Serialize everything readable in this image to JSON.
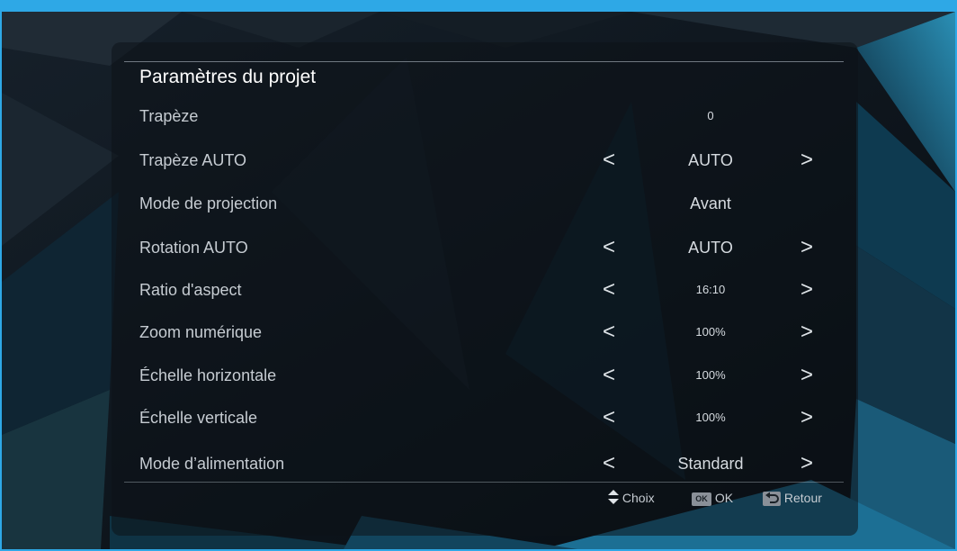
{
  "menu": {
    "title": "Paramètres du projet",
    "items": [
      {
        "label": "Trapèze",
        "value": "0",
        "arrows": false,
        "value_size": "sm"
      },
      {
        "label": "Trapèze AUTO",
        "value": "AUTO",
        "arrows": true,
        "value_size": "lg"
      },
      {
        "label": "Mode de projection",
        "value": "Avant",
        "arrows": false,
        "value_size": "lg"
      },
      {
        "label": "Rotation AUTO",
        "value": "AUTO",
        "arrows": true,
        "value_size": "lg"
      },
      {
        "label": "Ratio d'aspect",
        "value": "16:10",
        "arrows": true,
        "value_size": "sm"
      },
      {
        "label": "Zoom numérique",
        "value": "100%",
        "arrows": true,
        "value_size": "sm"
      },
      {
        "label": "Échelle horizontale",
        "value": "100%",
        "arrows": true,
        "value_size": "sm"
      },
      {
        "label": "Échelle verticale",
        "value": "100%",
        "arrows": true,
        "value_size": "sm"
      },
      {
        "label": "Mode d’alimentation",
        "value": "Standard",
        "arrows": true,
        "value_size": "lg"
      }
    ],
    "arrow_left": "<",
    "arrow_right": ">"
  },
  "footer": {
    "choix_label": "Choix",
    "ok_key": "OK",
    "ok_label": "OK",
    "retour_label": "Retour",
    "icons": {
      "choix": "up-down-icon",
      "ok": "ok-key-icon",
      "retour": "return-icon"
    }
  },
  "colors": {
    "frame": "#2ea8e6",
    "text": "#c6ccd2",
    "title": "#ffffff"
  }
}
